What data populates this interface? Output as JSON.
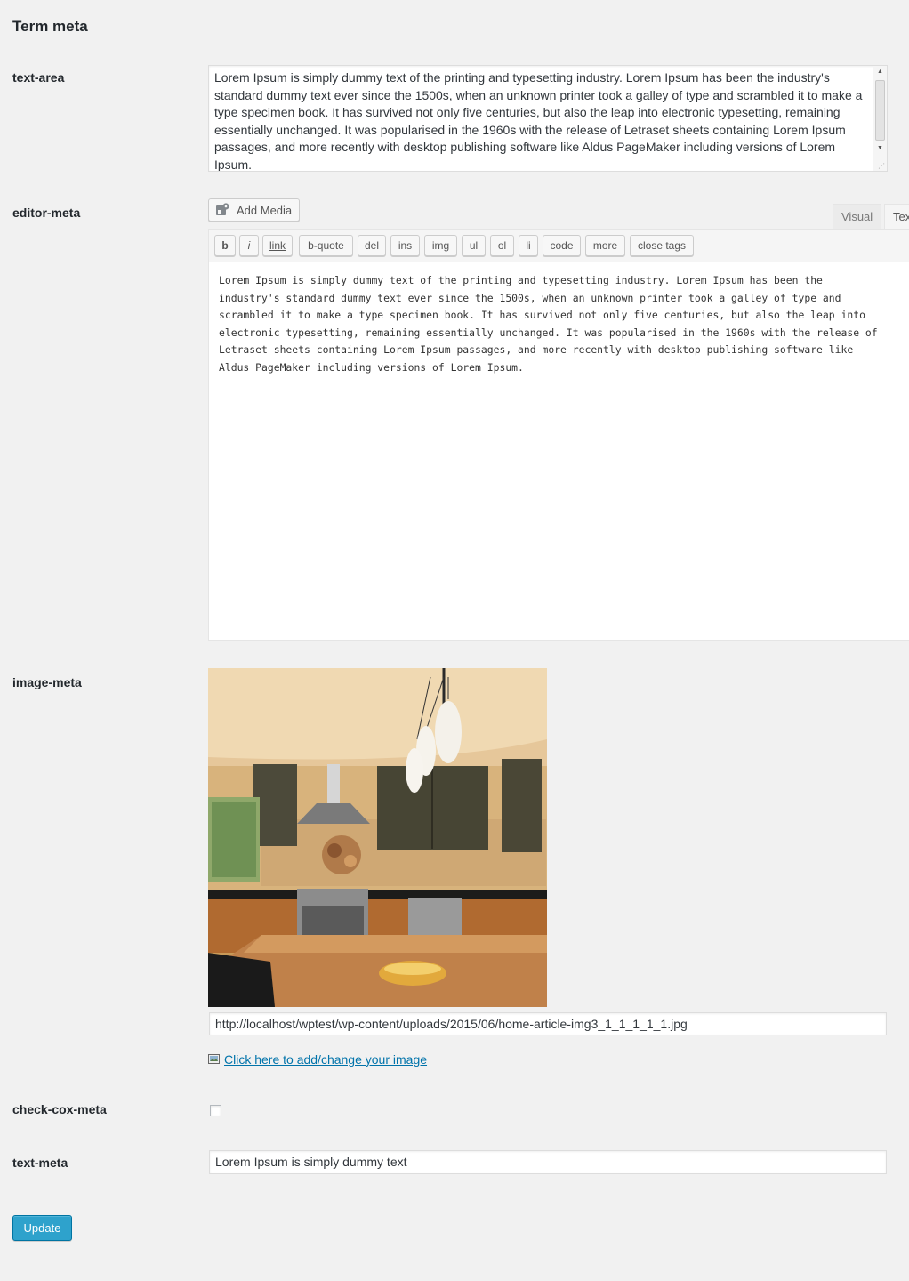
{
  "page_title": "Term meta",
  "fields": {
    "text_area": {
      "label": "text-area",
      "value": "Lorem Ipsum is simply dummy text of the printing and typesetting industry. Lorem Ipsum has been the industry's standard dummy text ever since the 1500s, when an unknown printer took a galley of type and scrambled it to make a type specimen book. It has survived not only five centuries, but also the leap into electronic typesetting, remaining essentially unchanged. It was popularised in the 1960s with the release of Letraset sheets containing Lorem Ipsum passages, and more recently with desktop publishing software like Aldus PageMaker including versions of Lorem Ipsum."
    },
    "editor": {
      "label": "editor-meta",
      "add_media": "Add Media",
      "tabs": {
        "visual": "Visual",
        "text": "Text"
      },
      "toolbar": [
        "b",
        "i",
        "link",
        "b-quote",
        "del",
        "ins",
        "img",
        "ul",
        "ol",
        "li",
        "code",
        "more",
        "close tags"
      ],
      "content": "Lorem Ipsum is simply dummy text of the printing and typesetting industry. Lorem Ipsum has been the industry's standard dummy text ever since the 1500s, when an unknown printer took a galley of type and scrambled it to make a type specimen book. It has survived not only five centuries, but also the leap into electronic typesetting, remaining essentially unchanged. It was popularised in the 1960s with the release of Letraset sheets containing Lorem Ipsum passages, and more recently with desktop publishing software like Aldus PageMaker including versions of Lorem Ipsum."
    },
    "image": {
      "label": "image-meta",
      "url": "http://localhost/wptest/wp-content/uploads/2015/06/home-article-img3_1_1_1_1_1.jpg",
      "change_link": "Click here to add/change your image",
      "link_icon": "image-icon"
    },
    "checkbox": {
      "label": "check-cox-meta",
      "checked": false
    },
    "text_meta": {
      "label": "text-meta",
      "value": "Lorem Ipsum is simply dummy text"
    }
  },
  "update_button": "Update",
  "colors": {
    "accent": "#2ea2cc",
    "link": "#0073aa",
    "background": "#f1f1f1"
  }
}
